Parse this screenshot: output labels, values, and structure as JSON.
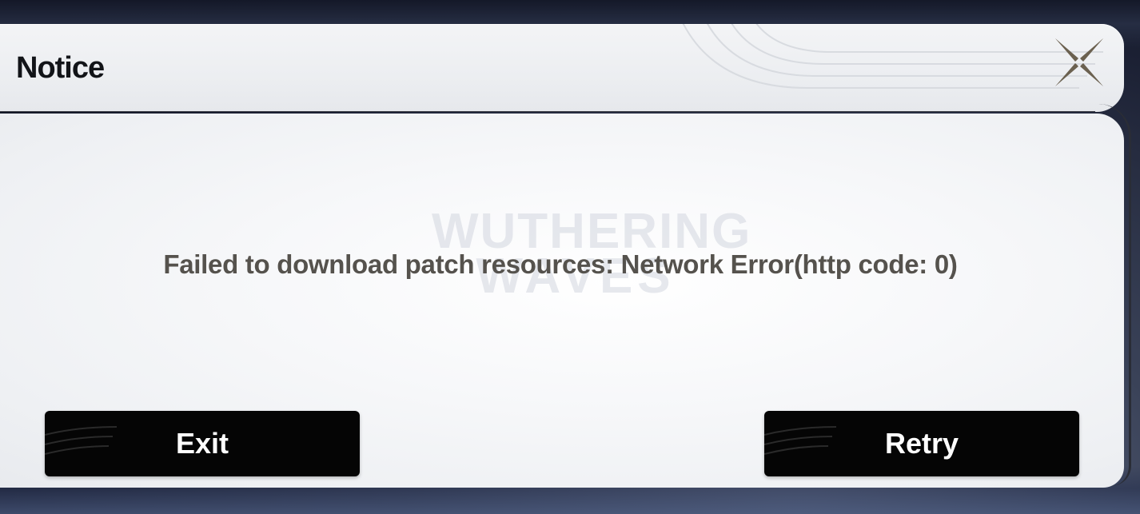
{
  "dialog": {
    "title": "Notice",
    "message": "Failed to download patch resources: Network Error(http code: 0)",
    "watermark": {
      "line1": "WUTHERING",
      "line2": "WAVES"
    },
    "close_icon": "close-x-icon",
    "buttons": {
      "exit_label": "Exit",
      "retry_label": "Retry"
    }
  },
  "colors": {
    "title_text": "#121418",
    "message_text": "#55524d",
    "button_bg": "#050505",
    "button_text": "#ffffff",
    "close_icon_color": "#6b6150"
  }
}
